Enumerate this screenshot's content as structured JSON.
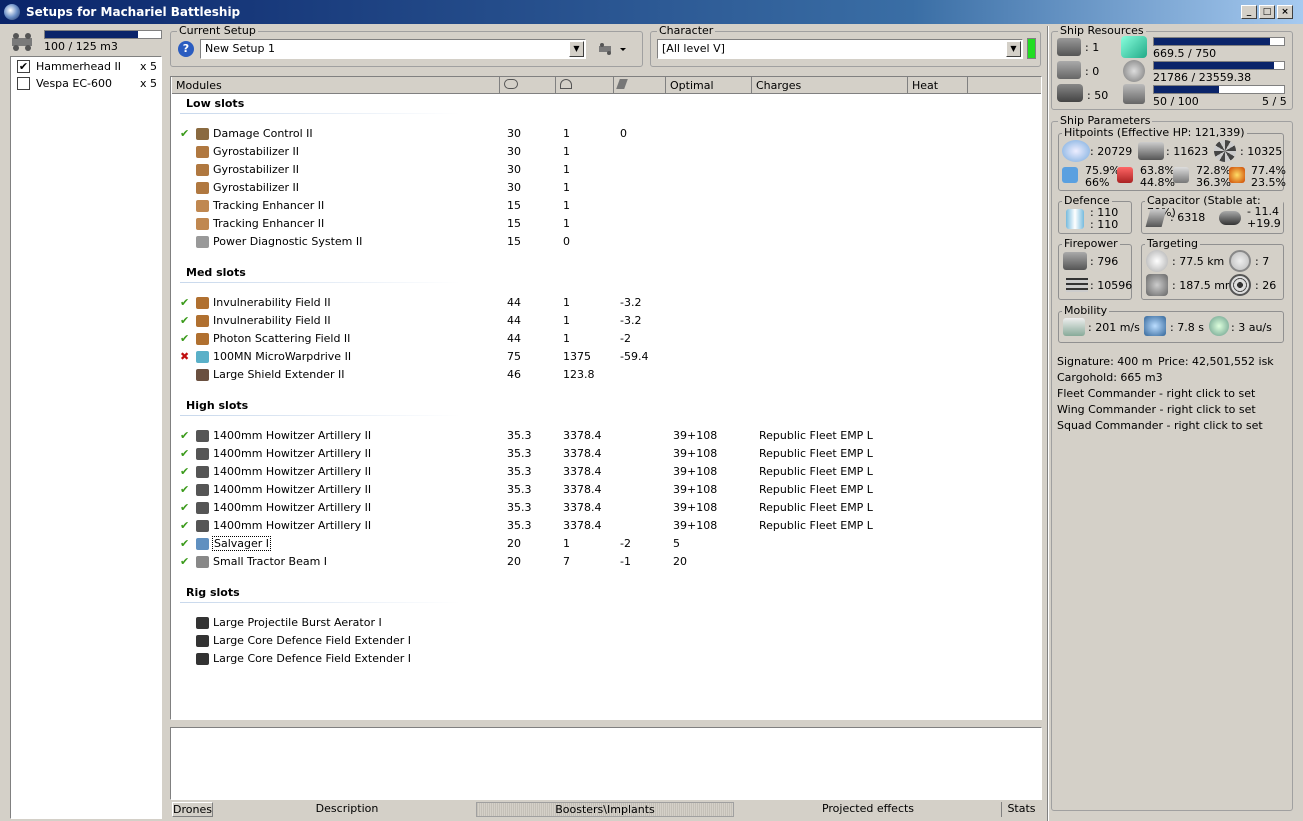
{
  "window": {
    "title": "Setups for Machariel Battleship"
  },
  "drone_panel": {
    "bay": "100 / 125 m3",
    "bay_fraction": 0.8,
    "drones": [
      {
        "name": "Hammerhead II",
        "qty": "x 5",
        "checked": true
      },
      {
        "name": "Vespa EC-600",
        "qty": "x 5",
        "checked": false
      }
    ]
  },
  "setup": {
    "label": "Current Setup",
    "value": "New Setup 1"
  },
  "character": {
    "label": "Character",
    "value": "[All level V]"
  },
  "columns": {
    "modules": "Modules",
    "optimal": "Optimal",
    "charges": "Charges",
    "heat": "Heat"
  },
  "sections": [
    {
      "title": "Low slots",
      "rows": [
        {
          "mark": "✔",
          "name": "Damage Control II",
          "c1": "30",
          "c2": "1",
          "c3": "0",
          "optimal": "",
          "charge": "",
          "icon": "damage-control-icon"
        },
        {
          "mark": "",
          "name": "Gyrostabilizer II",
          "c1": "30",
          "c2": "1",
          "c3": "",
          "optimal": "",
          "charge": "",
          "icon": "gyrostabilizer-icon"
        },
        {
          "mark": "",
          "name": "Gyrostabilizer II",
          "c1": "30",
          "c2": "1",
          "c3": "",
          "optimal": "",
          "charge": "",
          "icon": "gyrostabilizer-icon"
        },
        {
          "mark": "",
          "name": "Gyrostabilizer II",
          "c1": "30",
          "c2": "1",
          "c3": "",
          "optimal": "",
          "charge": "",
          "icon": "gyrostabilizer-icon"
        },
        {
          "mark": "",
          "name": "Tracking Enhancer II",
          "c1": "15",
          "c2": "1",
          "c3": "",
          "optimal": "",
          "charge": "",
          "icon": "tracking-enhancer-icon"
        },
        {
          "mark": "",
          "name": "Tracking Enhancer II",
          "c1": "15",
          "c2": "1",
          "c3": "",
          "optimal": "",
          "charge": "",
          "icon": "tracking-enhancer-icon"
        },
        {
          "mark": "",
          "name": "Power Diagnostic System II",
          "c1": "15",
          "c2": "0",
          "c3": "",
          "optimal": "",
          "charge": "",
          "icon": "power-diagnostic-icon"
        }
      ]
    },
    {
      "title": "Med slots",
      "rows": [
        {
          "mark": "✔",
          "name": "Invulnerability Field II",
          "c1": "44",
          "c2": "1",
          "c3": "-3.2",
          "optimal": "",
          "charge": "",
          "icon": "shield-hardener-icon"
        },
        {
          "mark": "✔",
          "name": "Invulnerability Field II",
          "c1": "44",
          "c2": "1",
          "c3": "-3.2",
          "optimal": "",
          "charge": "",
          "icon": "shield-hardener-icon"
        },
        {
          "mark": "✔",
          "name": "Photon Scattering Field II",
          "c1": "44",
          "c2": "1",
          "c3": "-2",
          "optimal": "",
          "charge": "",
          "icon": "shield-hardener-icon"
        },
        {
          "mark": "✖",
          "name": "100MN MicroWarpdrive II",
          "c1": "75",
          "c2": "1375",
          "c3": "-59.4",
          "optimal": "",
          "charge": "",
          "icon": "microwarpdrive-icon"
        },
        {
          "mark": "",
          "name": "Large Shield Extender II",
          "c1": "46",
          "c2": "123.8",
          "c3": "",
          "optimal": "",
          "charge": "",
          "icon": "shield-extender-icon"
        }
      ]
    },
    {
      "title": "High slots",
      "rows": [
        {
          "mark": "✔",
          "name": "1400mm Howitzer Artillery II",
          "c1": "35.3",
          "c2": "3378.4",
          "c3": "",
          "optimal": "39+108",
          "charge": "Republic Fleet EMP L",
          "icon": "artillery-icon"
        },
        {
          "mark": "✔",
          "name": "1400mm Howitzer Artillery II",
          "c1": "35.3",
          "c2": "3378.4",
          "c3": "",
          "optimal": "39+108",
          "charge": "Republic Fleet EMP L",
          "icon": "artillery-icon"
        },
        {
          "mark": "✔",
          "name": "1400mm Howitzer Artillery II",
          "c1": "35.3",
          "c2": "3378.4",
          "c3": "",
          "optimal": "39+108",
          "charge": "Republic Fleet EMP L",
          "icon": "artillery-icon"
        },
        {
          "mark": "✔",
          "name": "1400mm Howitzer Artillery II",
          "c1": "35.3",
          "c2": "3378.4",
          "c3": "",
          "optimal": "39+108",
          "charge": "Republic Fleet EMP L",
          "icon": "artillery-icon"
        },
        {
          "mark": "✔",
          "name": "1400mm Howitzer Artillery II",
          "c1": "35.3",
          "c2": "3378.4",
          "c3": "",
          "optimal": "39+108",
          "charge": "Republic Fleet EMP L",
          "icon": "artillery-icon"
        },
        {
          "mark": "✔",
          "name": "1400mm Howitzer Artillery II",
          "c1": "35.3",
          "c2": "3378.4",
          "c3": "",
          "optimal": "39+108",
          "charge": "Republic Fleet EMP L",
          "icon": "artillery-icon"
        },
        {
          "mark": "✔",
          "name": "Salvager I",
          "c1": "20",
          "c2": "1",
          "c3": "-2",
          "optimal": "5",
          "charge": "",
          "icon": "salvager-icon"
        },
        {
          "mark": "✔",
          "name": "Small Tractor Beam I",
          "c1": "20",
          "c2": "7",
          "c3": "-1",
          "optimal": "20",
          "charge": "",
          "icon": "tractor-beam-icon"
        }
      ]
    },
    {
      "title": "Rig slots",
      "rows": [
        {
          "mark": "",
          "name": "Large Projectile Burst Aerator I",
          "c1": "",
          "c2": "",
          "c3": "",
          "optimal": "",
          "charge": "",
          "icon": "rig-icon"
        },
        {
          "mark": "",
          "name": "Large Core Defence Field Extender I",
          "c1": "",
          "c2": "",
          "c3": "",
          "optimal": "",
          "charge": "",
          "icon": "rig-icon"
        },
        {
          "mark": "",
          "name": "Large Core Defence Field Extender I",
          "c1": "",
          "c2": "",
          "c3": "",
          "optimal": "",
          "charge": "",
          "icon": "rig-icon"
        }
      ]
    }
  ],
  "bottom_tabs": [
    "Drones",
    "Description",
    "Boosters\\Implants",
    "Projected effects",
    "Stats"
  ],
  "resources": {
    "label": "Ship Resources",
    "turret_slots": ": 1",
    "launcher_slots": ": 0",
    "calibration": ": 50",
    "cpu": "669.5 / 750",
    "cpu_fraction": 0.893,
    "powergrid": "21786 / 23559.38",
    "powergrid_fraction": 0.925,
    "drone_bandwidth": "50 / 100",
    "drone_bandwidth_fraction": 0.5,
    "drones_active": "5 / 5"
  },
  "params": {
    "label": "Ship Parameters",
    "hitpoints_label": "Hitpoints (Effective HP: 121,339)",
    "shield_hp": ": 20729",
    "armor_hp": ": 11623",
    "structure_hp": ": 10325",
    "res1_top": "75.9%",
    "res1_bot": "66%",
    "res2_top": "63.8%",
    "res2_bot": "44.8%",
    "res3_top": "72.8%",
    "res3_bot": "36.3%",
    "res4_top": "77.4%",
    "res4_bot": "23.5%",
    "defence_label": "Defence",
    "defence_1": ": 110",
    "defence_2": ": 110",
    "capacitor_label": "Capacitor (Stable at: 70%)",
    "capacitor": ": 6318",
    "cap_delta_1": "- 11.4",
    "cap_delta_2": "+19.9",
    "firepower_label": "Firepower",
    "volley": ": 796",
    "dps": ": 10596",
    "targeting_label": "Targeting",
    "range": ": 77.5 km",
    "max_targets": ": 7",
    "scan_res": ": 187.5 mm",
    "sensor_strength": ": 26",
    "mobility_label": "Mobility",
    "speed": ": 201 m/s",
    "align": ": 7.8 s",
    "warp": ": 3 au/s",
    "signature": "Signature: 400 m",
    "price": "Price: 42,501,552 isk",
    "cargohold": "Cargohold: 665 m3",
    "fleet": "Fleet Commander - right click to set",
    "wing": "Wing Commander - right click to set",
    "squad": "Squad Commander - right click to set"
  }
}
